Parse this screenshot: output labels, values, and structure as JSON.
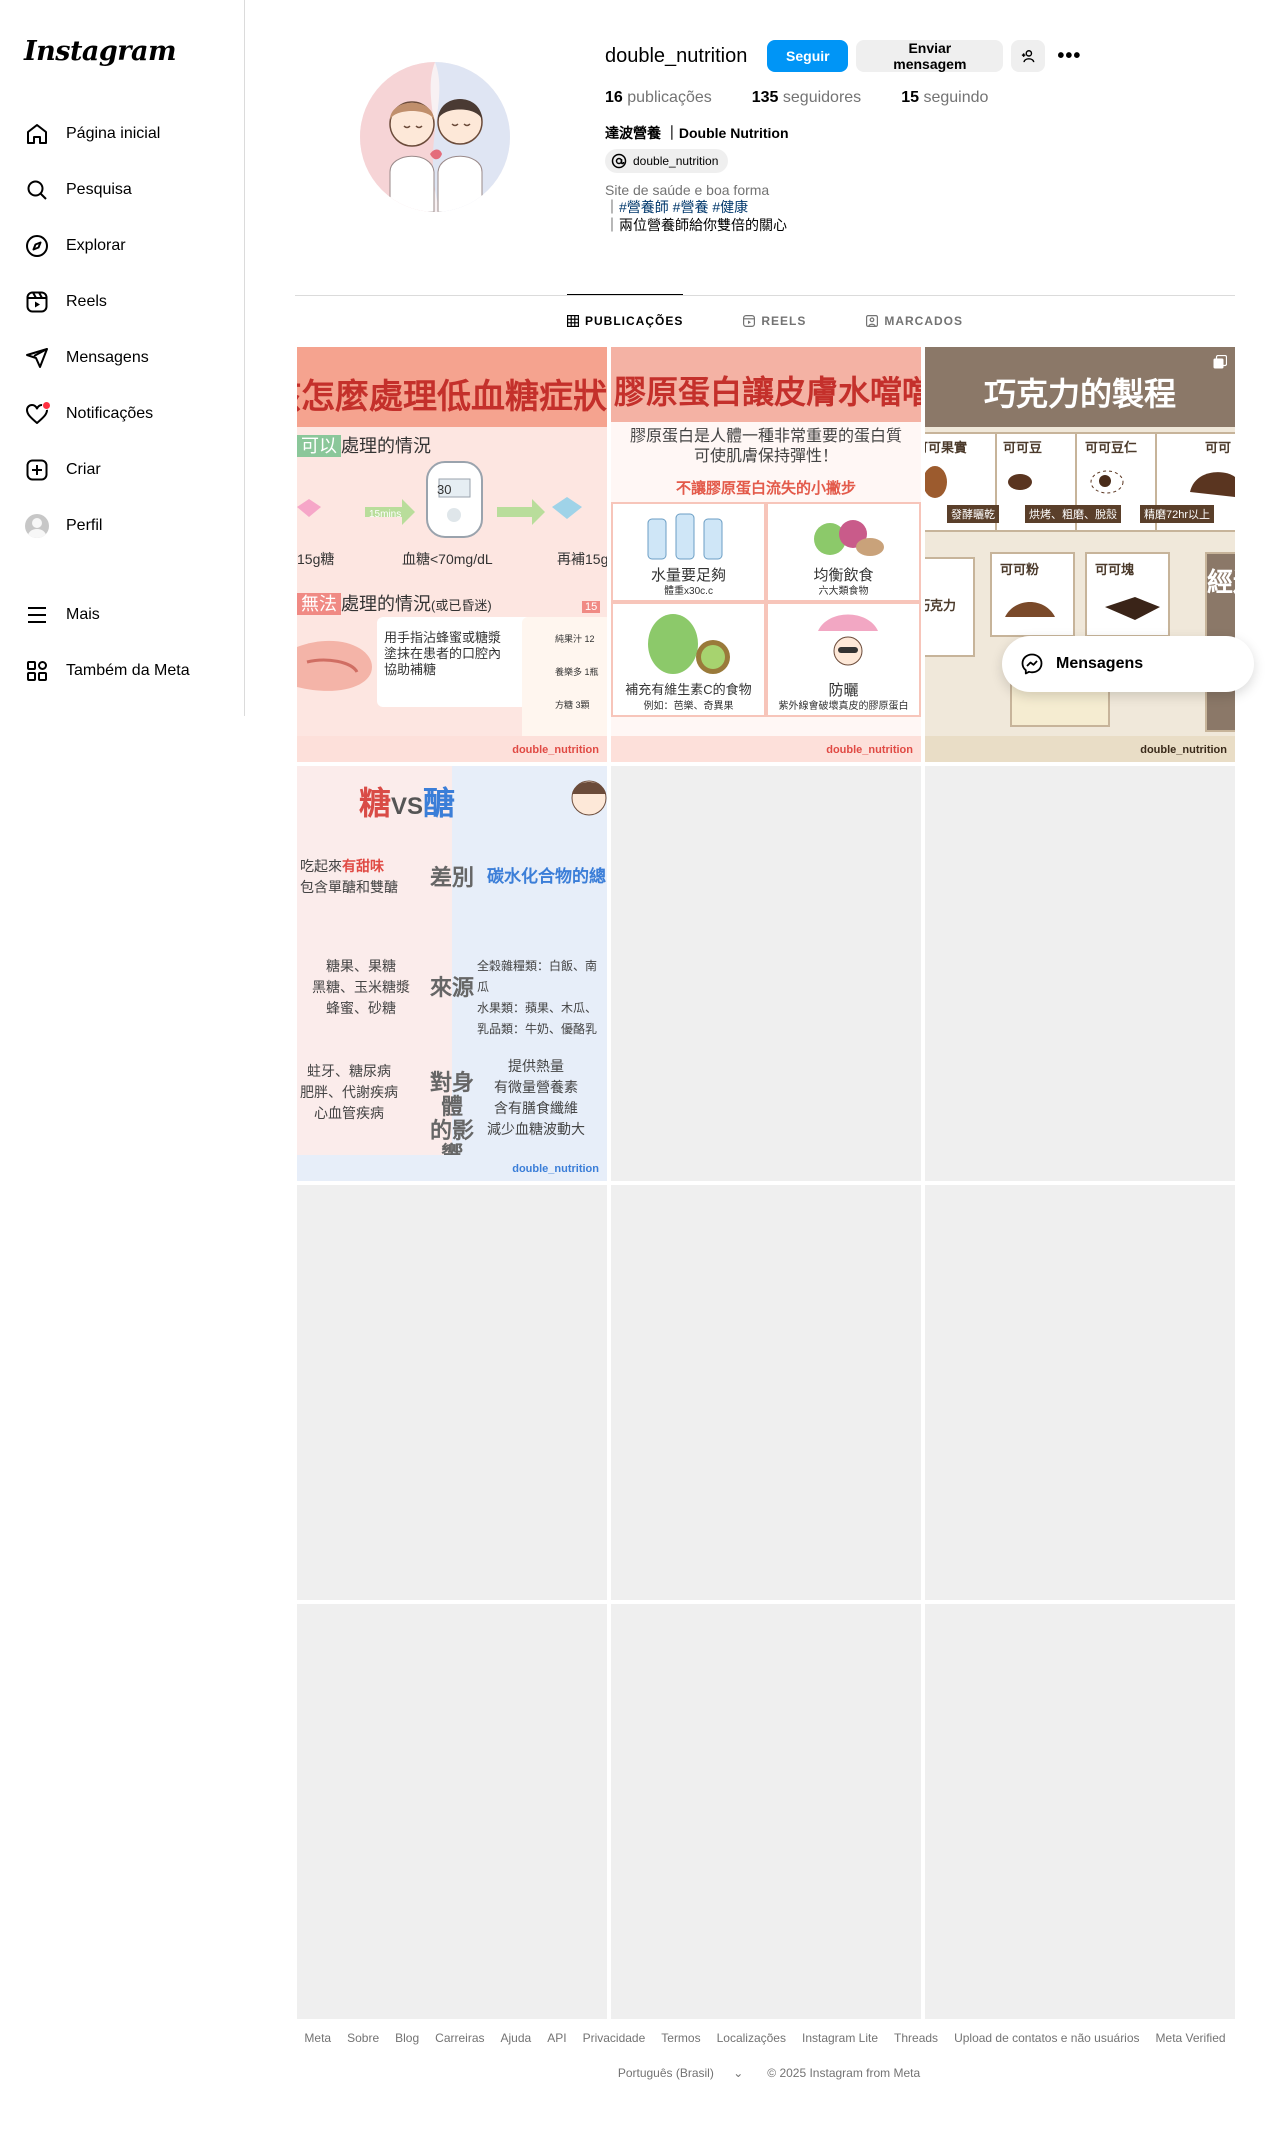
{
  "brand": "Instagram",
  "nav": {
    "items": [
      {
        "label": "Página inicial",
        "icon": "home-icon"
      },
      {
        "label": "Pesquisa",
        "icon": "search-icon"
      },
      {
        "label": "Explorar",
        "icon": "compass-icon"
      },
      {
        "label": "Reels",
        "icon": "reels-icon"
      },
      {
        "label": "Mensagens",
        "icon": "paper-plane-icon"
      },
      {
        "label": "Notificações",
        "icon": "heart-icon"
      },
      {
        "label": "Criar",
        "icon": "plus-square-icon"
      },
      {
        "label": "Perfil",
        "icon": "avatar-icon"
      }
    ],
    "bottom": [
      {
        "label": "Mais",
        "icon": "menu-icon"
      },
      {
        "label": "Também da Meta",
        "icon": "meta-grid-icon"
      }
    ]
  },
  "profile": {
    "username": "double_nutrition",
    "follow_label": "Seguir",
    "message_label": "Enviar mensagem",
    "stats": {
      "posts_num": "16",
      "posts_label": "publicações",
      "followers_num": "135",
      "followers_label": "seguidores",
      "following_num": "15",
      "following_label": "seguindo"
    },
    "full_name": "達波營養 ｜Double Nutrition",
    "threads_handle": "double_nutrition",
    "category": "Site de saúde e boa forma",
    "bio_tags": "#營養師 #營養 #健康",
    "bio_line2": "兩位營養師給你雙倍的關心",
    "bio_bar": "｜"
  },
  "tabs": [
    {
      "label": "PUBLICAÇÕES",
      "active": true
    },
    {
      "label": "REELS",
      "active": false
    },
    {
      "label": "MARCADOS",
      "active": false
    }
  ],
  "posts": {
    "p1": {
      "title": "該怎麼處理低血糖症狀",
      "sec1_hl": "可以",
      "sec1_rest": "處理的情況",
      "timer": "15mins",
      "left_label": "15g糖",
      "mid_label": "血糖<70mg/dL",
      "right_label": "再補15g",
      "sec2_hl": "無法",
      "sec2_rest": "處理的情況",
      "sec2_note": "(或已昏迷)",
      "tip_line1": "用手指沾蜂蜜或糖漿",
      "tip_line2": "塗抹在患者的口腔內",
      "tip_line3": "協助補糖",
      "side1": "純果汁 12",
      "side2": "養樂多 1瓶",
      "side3": "方糖 3顆",
      "side_top": "15",
      "gauge": "30",
      "watermark": "double_nutrition"
    },
    "p2": {
      "title": "膠原蛋白讓皮膚水噹噹",
      "lead1": "膠原蛋白是人體一種非常重要的蛋白質",
      "lead2": "可使肌膚保持彈性！",
      "sub": "不讓膠原蛋白流失的小撇步",
      "q1": "水量要足夠",
      "q1s": "體重x30c.c",
      "q2": "均衡飲食",
      "q2s": "六大類食物",
      "q3": "補充有維生素C的食物",
      "q3s": "例如：芭樂、奇異果",
      "q4": "防曬",
      "q4s": "紫外線會破壞真皮的膠原蛋白",
      "watermark": "double_nutrition"
    },
    "p3": {
      "title": "巧克力的製程",
      "b1": "可可果實",
      "b2": "可可豆",
      "b3": "可可豆仁",
      "b4": "可可",
      "t1": "發酵曬乾",
      "t2": "烘烤、粗磨、脫殼",
      "t3": "精磨72hr以上",
      "b5": "可可粉",
      "b6": "可可塊",
      "b7": "巧克力",
      "b8": "經過",
      "watermark": "double_nutrition"
    },
    "p4": {
      "title_a": "糖",
      "title_vs": "VS",
      "title_b": "醣",
      "row1_mid": "差別",
      "row1_left1": "吃起來",
      "row1_left_hl": "有甜味",
      "row1_left2": "包含單醣和雙醣",
      "row1_right": "碳水化合物的總",
      "row2_mid": "來源",
      "row2_left": "糖果、果糖\n黑糖、玉米糖漿\n蜂蜜、砂糖",
      "row2_right": "全穀雜糧類：白飯、南瓜\n水果類：蘋果、木瓜、\n乳品類：牛奶、優酪乳",
      "row3_mid": "對身體\n的影響",
      "row3_left": "蛀牙、糖尿病\n肥胖、代謝疾病\n心血管疾病",
      "row3_right": "提供熱量\n有微量營養素\n含有膳食纖維\n減少血糖波動大",
      "watermark": "double_nutrition"
    }
  },
  "floating_messages": {
    "label": "Mensagens"
  },
  "footer": {
    "links": [
      "Meta",
      "Sobre",
      "Blog",
      "Carreiras",
      "Ajuda",
      "API",
      "Privacidade",
      "Termos",
      "Localizações",
      "Instagram Lite",
      "Threads",
      "Upload de contatos e não usuários",
      "Meta Verified"
    ],
    "language": "Português (Brasil)",
    "copyright": "© 2025 Instagram from Meta"
  },
  "colors": {
    "accent": "#0095f6",
    "notification": "#ff3040",
    "muted": "#737373",
    "border": "#dbdbdb"
  }
}
